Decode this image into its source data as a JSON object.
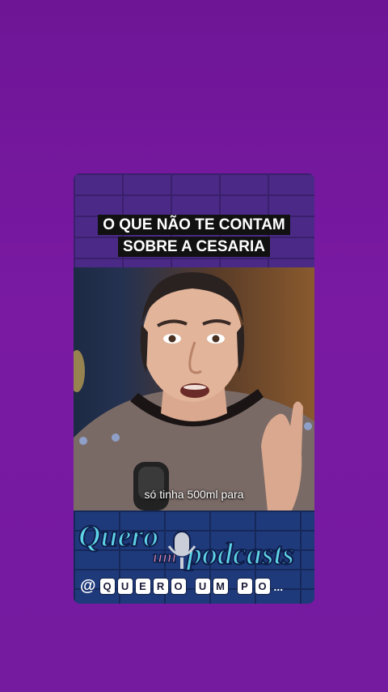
{
  "headline": {
    "line1": "O QUE NÃO TE CONTAM",
    "line2": "SOBRE A CESARIA"
  },
  "caption": "só tinha 500ml para",
  "brand": {
    "logo_text": "Quero um podcasts",
    "handle_prefix": "@",
    "handle_tiles_1": [
      "Q",
      "U",
      "E",
      "R",
      "O"
    ],
    "handle_tiles_2": [
      "U",
      "M"
    ],
    "handle_tiles_3": [
      "P",
      "O"
    ],
    "handle_suffix": "..."
  },
  "colors": {
    "background": "#741ba0",
    "brick_top": "#4a2a86",
    "brick_bottom": "#1f3a7a",
    "logo_fill": "#5fd3e8",
    "logo_accent": "#d98ab0"
  }
}
